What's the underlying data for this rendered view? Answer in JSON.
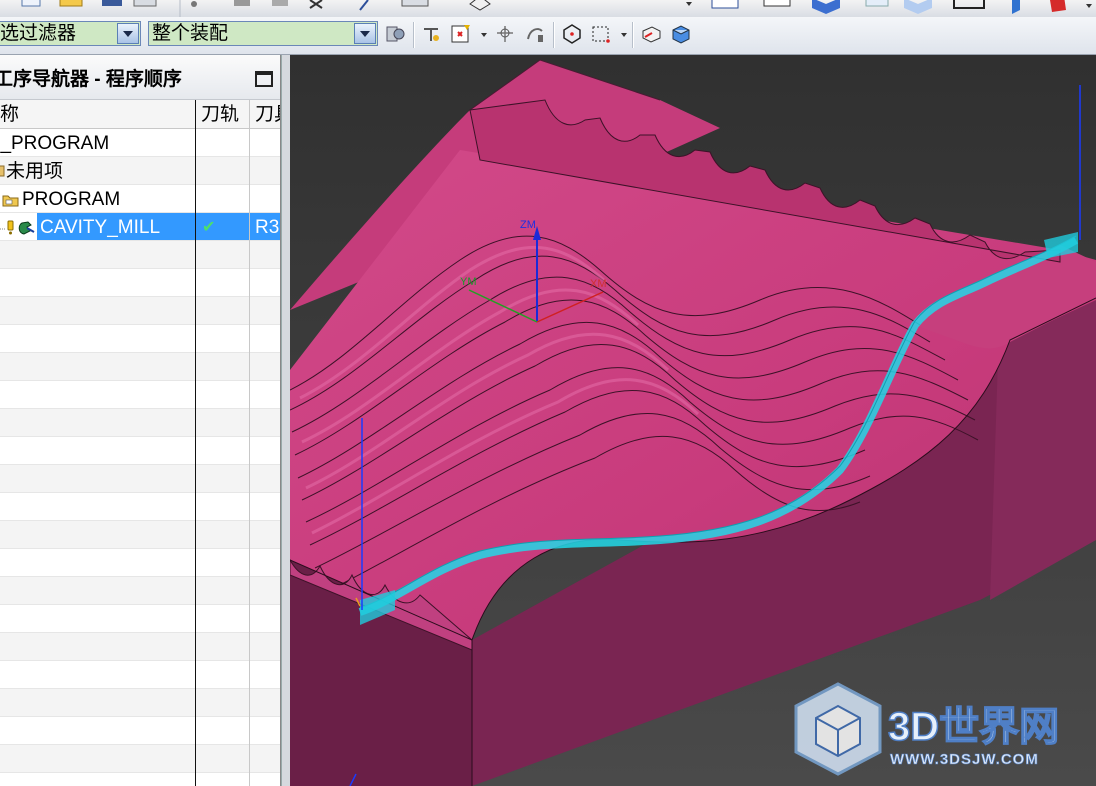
{
  "toolbar": {
    "filter_combo": "选过滤器",
    "assembly_combo": "整个装配"
  },
  "navigator": {
    "title": "工序导航器 - 程序顺序",
    "columns": {
      "name": "名称",
      "toolpath": "刀轨",
      "tool": "刀具"
    },
    "rows": [
      {
        "name": "NC_PROGRAM",
        "toolpath": "",
        "tool": ""
      },
      {
        "name": "未用项",
        "toolpath": "",
        "tool": ""
      },
      {
        "name": "PROGRAM",
        "toolpath": "",
        "tool": ""
      },
      {
        "name": "CAVITY_MILL",
        "toolpath": "✔",
        "tool": "R3"
      }
    ],
    "selected_row": "CAVITY_MILL"
  },
  "viewport": {
    "axes": {
      "z": "ZM",
      "y": "YM",
      "x": "XM"
    },
    "colors": {
      "part_top": "#c83b7c",
      "part_side": "#7a2450",
      "toolpath": "#22d8e8",
      "background": "#353535"
    }
  },
  "watermark": {
    "title": "3D世界网",
    "url": "WWW.3DSJW.COM"
  }
}
